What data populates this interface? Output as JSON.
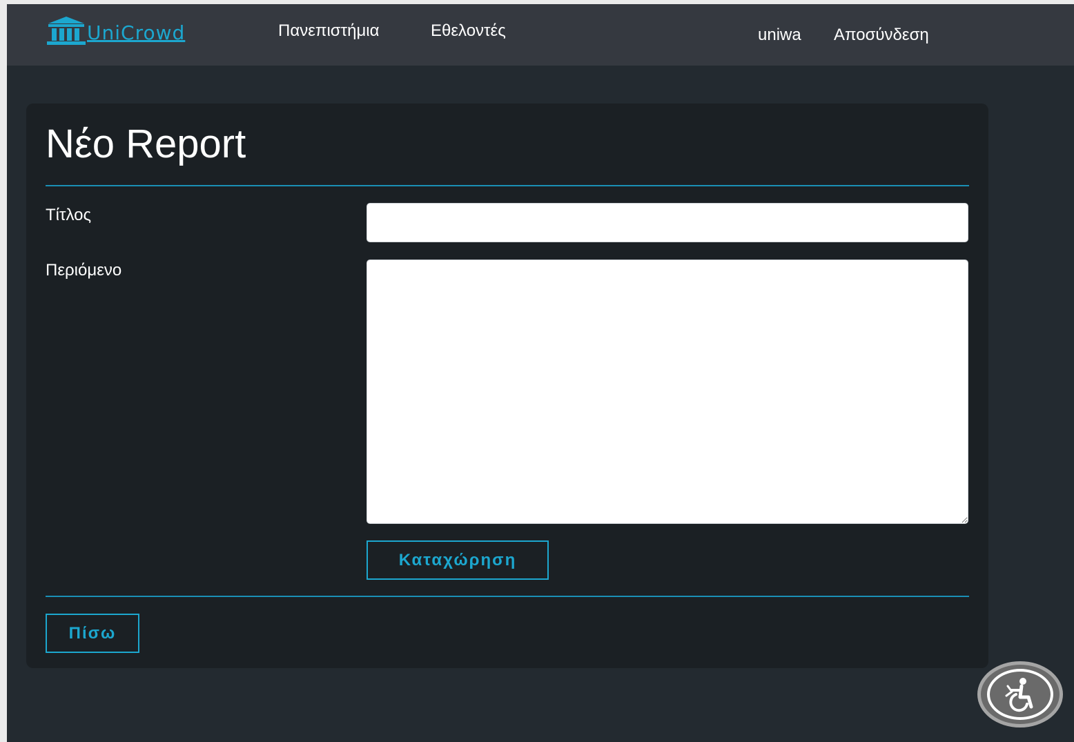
{
  "brand": {
    "name": "UniCrowd",
    "icon": "university-building-icon",
    "color": "#1ca7cf"
  },
  "nav": {
    "universities": "Πανεπιστήμια",
    "volunteers": "Εθελοντές",
    "user": "uniwa",
    "logout": "Αποσύνδεση"
  },
  "page": {
    "title": "Νέο Report"
  },
  "form": {
    "title_label": "Τίτλος",
    "title_value": "",
    "content_label": "Περιόμενο",
    "content_value": "",
    "submit_label": "Καταχώρηση"
  },
  "footer": {
    "back_label": "Πίσω"
  },
  "accessibility": {
    "icon": "accessibility-icon"
  },
  "colors": {
    "accent": "#1ca7cf",
    "navbar": "#353940",
    "background": "#232a30",
    "card": "#1b2024"
  }
}
